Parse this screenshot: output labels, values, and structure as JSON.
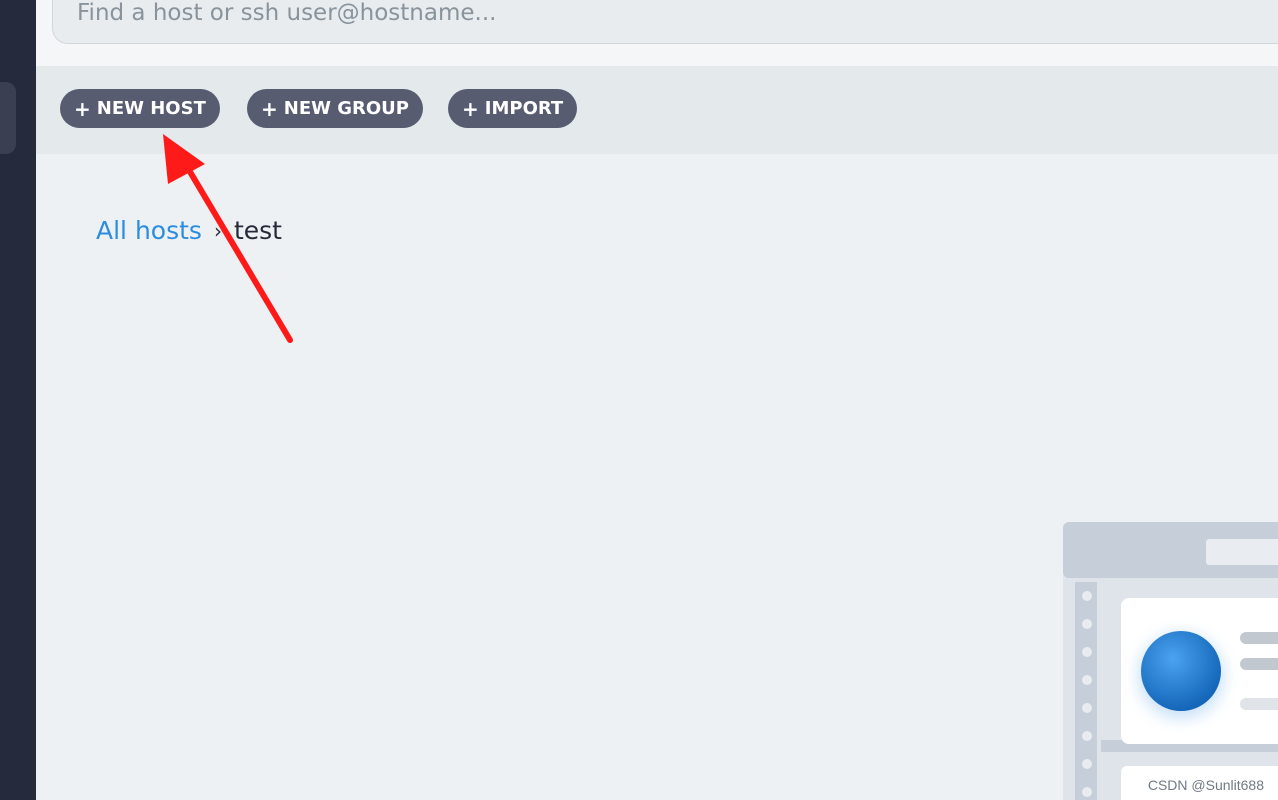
{
  "search": {
    "placeholder": "Find a host or ssh user@hostname..."
  },
  "toolbar": {
    "buttons": [
      {
        "icon": "plus-icon",
        "label": "NEW HOST"
      },
      {
        "icon": "plus-icon",
        "label": "NEW GROUP"
      },
      {
        "icon": "plus-icon",
        "label": "IMPORT"
      }
    ]
  },
  "breadcrumb": {
    "root": "All hosts",
    "separator": "›",
    "current": "test"
  },
  "annotation": {
    "color": "#ff1a1a",
    "points_to": "new-host-button"
  },
  "watermark": "CSDN @Sunlit688",
  "colors": {
    "sidebar": "#262a3d",
    "button": "#585c71",
    "link": "#2b8de0",
    "background": "#edf1f3"
  }
}
